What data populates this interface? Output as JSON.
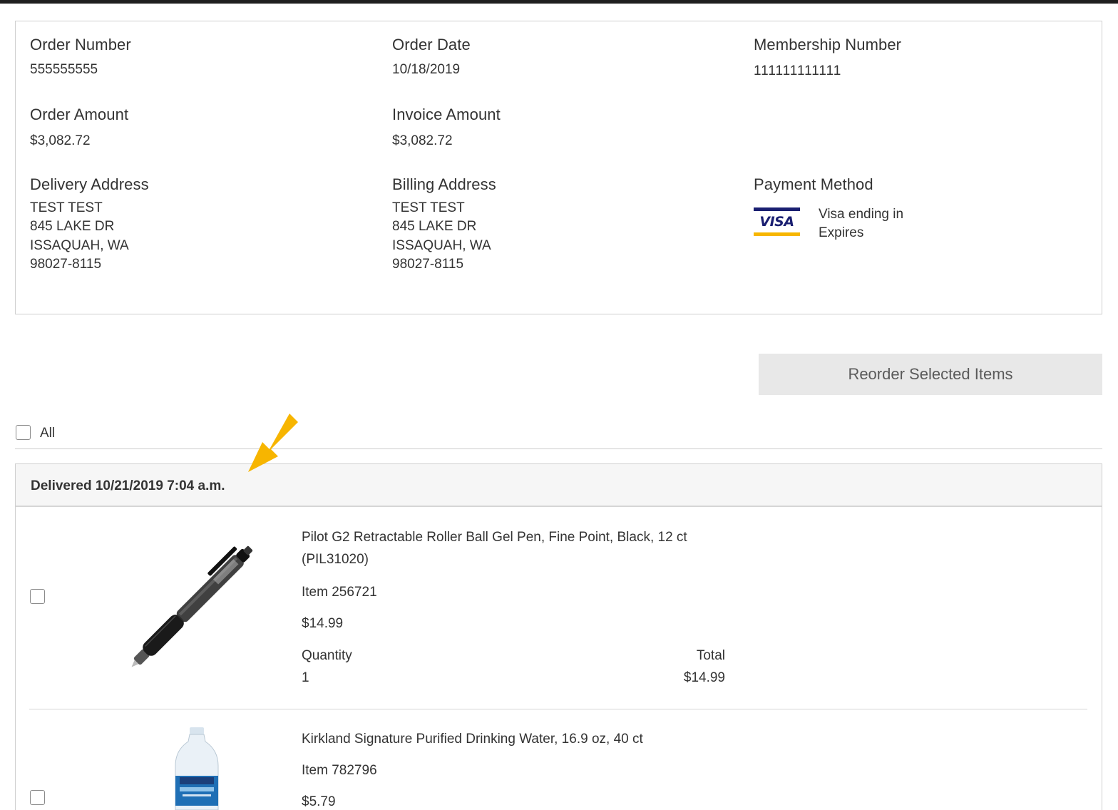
{
  "order": {
    "order_number_label": "Order Number",
    "order_number": "555555555",
    "order_date_label": "Order Date",
    "order_date": "10/18/2019",
    "membership_label": "Membership Number",
    "membership_number": "111111111111",
    "order_amount_label": "Order Amount",
    "order_amount": "$3,082.72",
    "invoice_amount_label": "Invoice Amount",
    "invoice_amount": "$3,082.72",
    "delivery_label": "Delivery Address",
    "delivery_address": [
      "TEST TEST",
      "845 LAKE DR",
      "ISSAQUAH, WA",
      "98027-8115"
    ],
    "billing_label": "Billing Address",
    "billing_address": [
      "TEST TEST",
      "845 LAKE DR",
      "ISSAQUAH, WA",
      "98027-8115"
    ],
    "payment_label": "Payment Method",
    "card_brand": "VISA",
    "card_line1": "Visa ending in",
    "card_line2": "Expires"
  },
  "actions": {
    "reorder_label": "Reorder Selected Items",
    "select_all_label": "All"
  },
  "shipment": {
    "delivered_text": "Delivered 10/21/2019 7:04 a.m."
  },
  "items": [
    {
      "title": "Pilot G2 Retractable Roller Ball Gel Pen, Fine Point, Black, 12 ct (PIL31020)",
      "item_no": "Item 256721",
      "price": "$14.99",
      "quantity_label": "Quantity",
      "quantity": "1",
      "total_label": "Total",
      "total": "$14.99"
    },
    {
      "title": "Kirkland Signature Purified Drinking Water, 16.9 oz, 40 ct",
      "item_no": "Item 782796",
      "price": "$5.79"
    }
  ],
  "colors": {
    "annotation_arrow": "#f7b500",
    "visa_blue": "#1a1f71",
    "visa_gold": "#f7b600"
  }
}
